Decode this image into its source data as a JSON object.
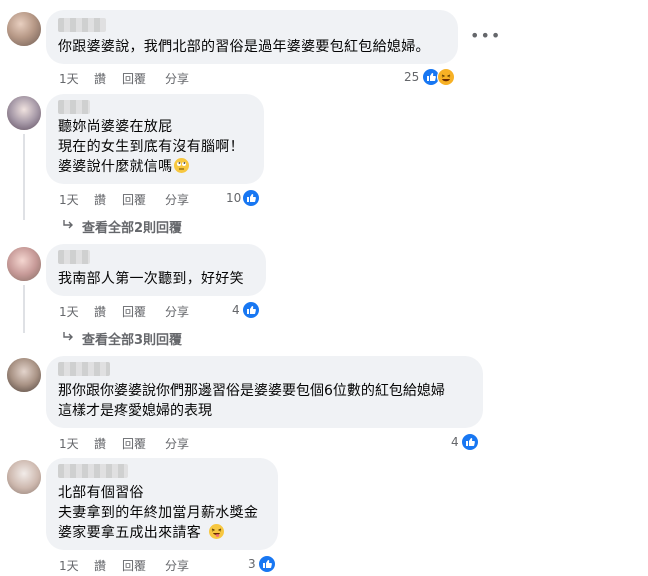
{
  "comments": [
    {
      "text": "你跟婆婆說，我們北部的習俗是過年婆婆要包紅包給媳婦。",
      "time": "1天",
      "like_action": "讚",
      "reply_action": "回覆",
      "share_action": "分享",
      "reaction_count": "25",
      "reactions": [
        "like-icon",
        "haha-icon"
      ]
    },
    {
      "lines": [
        "聽妳尚婆婆在放屁",
        "現在的女生到底有沒有腦啊！",
        "婆婆說什麼就信嗎"
      ],
      "trailing_emoji": "face-with-rolling-eyes-icon",
      "time": "1天",
      "like_action": "讚",
      "reply_action": "回覆",
      "share_action": "分享",
      "reaction_count": "10",
      "replies_link": "查看全部2則回覆"
    },
    {
      "text": "我南部人第一次聽到，好好笑",
      "time": "1天",
      "like_action": "讚",
      "reply_action": "回覆",
      "share_action": "分享",
      "reaction_count": "4",
      "replies_link": "查看全部3則回覆"
    },
    {
      "lines": [
        "那你跟你婆婆說你們那邊習俗是婆婆要包個6位數的紅包給媳婦",
        "這樣才是疼愛媳婦的表現"
      ],
      "time": "1天",
      "like_action": "讚",
      "reply_action": "回覆",
      "share_action": "分享",
      "reaction_count": "4"
    },
    {
      "lines": [
        "北部有個習俗",
        "夫妻拿到的年終加當月薪水獎金",
        "婆家要拿五成出來請客"
      ],
      "trailing_emoji": "winking-face-with-tongue-icon",
      "time": "1天",
      "like_action": "讚",
      "reply_action": "回覆",
      "share_action": "分享",
      "reaction_count": "3"
    }
  ],
  "colors": {
    "bubble": "#f0f2f5",
    "meta_text": "#65676b",
    "like_blue": "#1877f2",
    "haha_yellow": "#f7b125"
  }
}
